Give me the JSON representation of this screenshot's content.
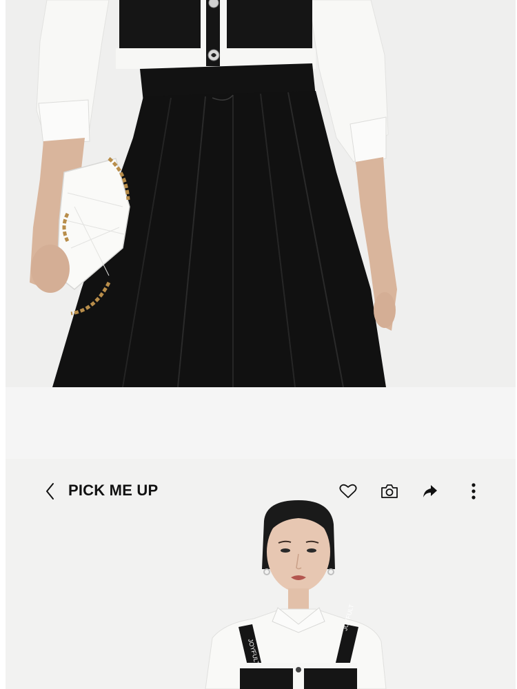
{
  "header": {
    "title": "PICK ME UP",
    "icons": {
      "back": "chevron-left-icon",
      "favorite": "heart-icon",
      "camera": "camera-icon",
      "share": "share-icon",
      "more": "more-vertical-icon"
    }
  },
  "product_photos": [
    {
      "description_visible": false
    },
    {
      "description_visible": false
    }
  ],
  "model_strap_text": "JOYFULT",
  "colors": {
    "background": "#ffffff",
    "photo_bg": "#f0f0ef",
    "garment_black": "#111111",
    "garment_white": "#f7f7f5"
  }
}
